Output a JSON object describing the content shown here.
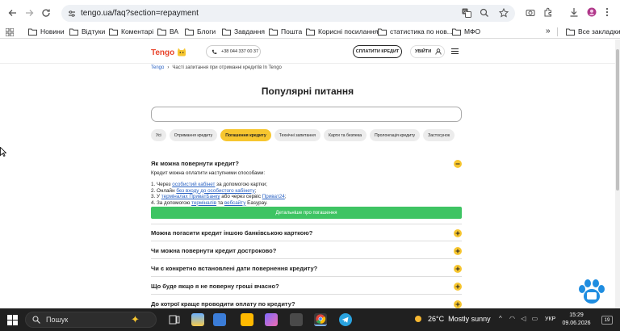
{
  "browser": {
    "url": "tengo.ua/faq?section=repayment",
    "bookmarks": [
      "Новини",
      "Відтуки",
      "Коментарі",
      "ВА",
      "Блоги",
      "Завдання",
      "Пошта",
      "Корисні посилання",
      "статистика по нов...",
      "МФО"
    ],
    "all_bookmarks": "Все закладки"
  },
  "header": {
    "logo": "Tengo",
    "phone": "+38 044 337 00 37",
    "pay_button": "СПЛАТИТИ КРЕДИТ",
    "login_button": "УВІЙТИ"
  },
  "breadcrumb": {
    "home": "Tengo",
    "current": "Часті запитання при отриманні кредитів In Tengo"
  },
  "page_title": "Популярні питання",
  "tabs": [
    "Усі",
    "Отримання кредиту",
    "Погашення кредиту",
    "Технічні запитання",
    "Карти та безпека",
    "Пролонгація кредиту",
    "Застосунок"
  ],
  "active_tab": "Погашення кредиту",
  "faq_open": {
    "question": "Як можна повернути кредит?",
    "intro": "Кредит можна оплатити наступними способами:",
    "step1_pre": "1. Через ",
    "step1_link": "особистий кабінет",
    "step1_post": " за допомогою картки;",
    "step2_pre": "2. Онлайн ",
    "step2_link": "без входу до особистого кабінету",
    "step2_post": ";",
    "step3_pre": "3. У ",
    "step3_link": "терміналах ПриватБанку",
    "step3_mid": " або через сервіс ",
    "step3_link2": "Приват24",
    "step3_post": ";",
    "step4_pre": "4. За допомогою ",
    "step4_link": "терміналів",
    "step4_mid": " та ",
    "step4_link2": "вебсайту",
    "step4_post": " Easypay.",
    "details_button": "Детальніше про погашення"
  },
  "faq_collapsed": [
    "Можна погасити кредит іншою банківською карткою?",
    "Чи можна повернути кредит достроково?",
    "Чи є конкретно встановлені дати повернення кредиту?",
    "Що буде якщо я не поверну гроші вчасно?",
    "До котрої краще проводити оплату по кредиту?"
  ],
  "taskbar": {
    "search_placeholder": "Пошук",
    "weather_temp": "26°C",
    "weather_text": "Mostly sunny",
    "lang": "УКР",
    "time": "15:29",
    "date": "09.06.2026",
    "notifications": "19"
  },
  "colors": {
    "accent": "#f7c62f",
    "green": "#3ec463",
    "link": "#2b63c4",
    "paw": "#1f8de0"
  }
}
